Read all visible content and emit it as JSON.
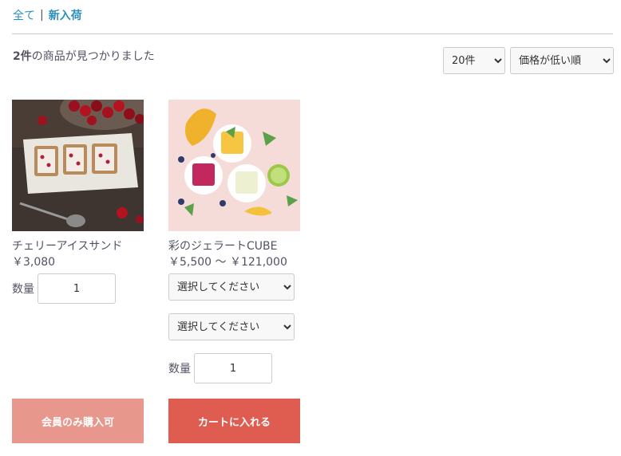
{
  "breadcrumb": {
    "all": "全て",
    "separator": "|",
    "current": "新入荷"
  },
  "results": {
    "count": "2件",
    "suffix": "の商品が見つかりました"
  },
  "sort": {
    "per_page": "20件",
    "order": "価格が低い順"
  },
  "products": [
    {
      "name": "チェリーアイスサンド",
      "price": "￥3,080",
      "qty_label": "数量",
      "qty_value": "1",
      "button": "会員のみ購入可",
      "image": "cherry-ice-sandwich-photo"
    },
    {
      "name": "彩のジェラートCUBE",
      "price": "￥5,500 ～ ￥121,000",
      "option1": "選択してください",
      "option2": "選択してください",
      "qty_label": "数量",
      "qty_value": "1",
      "button": "カートに入れる",
      "image": "gelato-cube-photo"
    }
  ],
  "colors": {
    "link": "#2a8fbd",
    "text": "#525263",
    "member_button": "#e8978d",
    "cart_button": "#de5d50"
  }
}
